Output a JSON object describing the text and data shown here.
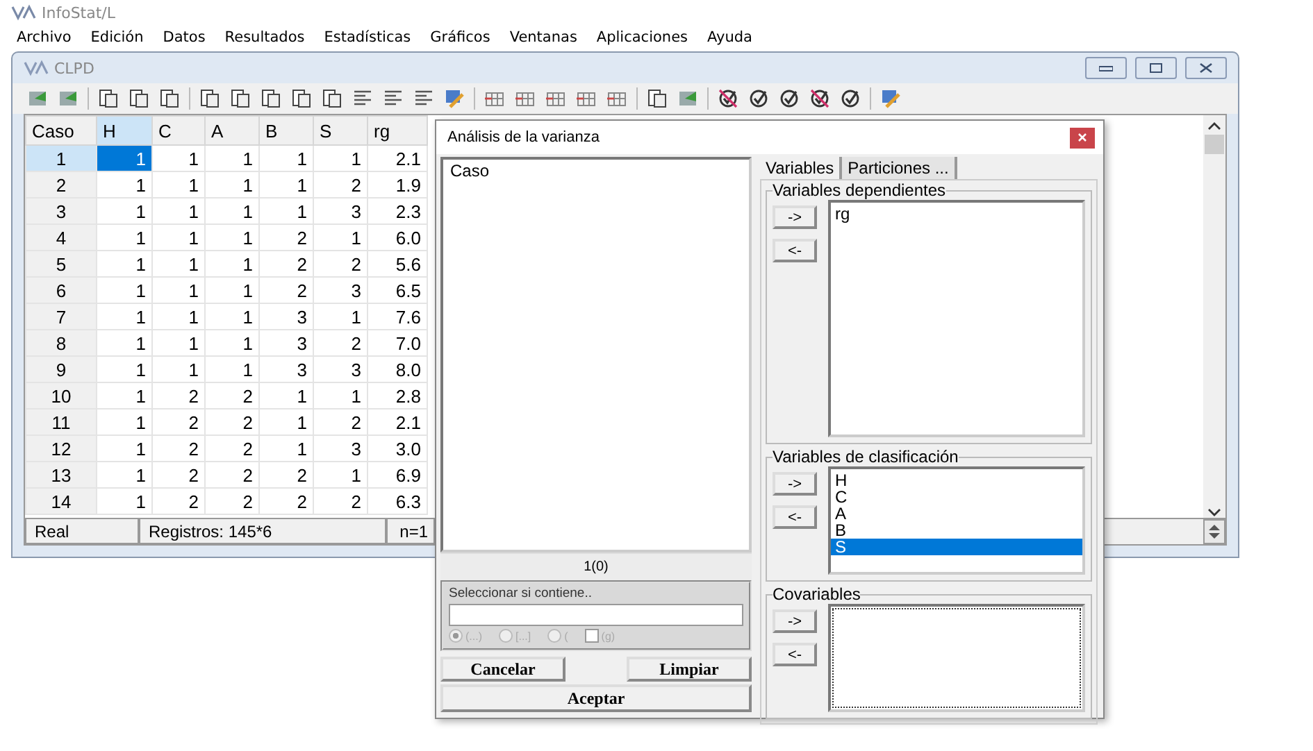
{
  "app": {
    "title": "InfoStat/L"
  },
  "menu": [
    "Archivo",
    "Edición",
    "Datos",
    "Resultados",
    "Estadísticas",
    "Gráficos",
    "Ventanas",
    "Aplicaciones",
    "Ayuda"
  ],
  "data_window": {
    "title": "CLPD",
    "table": {
      "columns": [
        {
          "label": "Caso",
          "selected": false
        },
        {
          "label": "H",
          "selected": true
        },
        {
          "label": "C",
          "selected": false
        },
        {
          "label": "A",
          "selected": false
        },
        {
          "label": "B",
          "selected": false
        },
        {
          "label": "S",
          "selected": false
        },
        {
          "label": "rg",
          "selected": false
        }
      ],
      "rows": [
        {
          "selected": true,
          "cells": [
            "1",
            "1",
            "1",
            "1",
            "1",
            "1",
            "2.1"
          ]
        },
        {
          "selected": false,
          "cells": [
            "2",
            "1",
            "1",
            "1",
            "1",
            "2",
            "1.9"
          ]
        },
        {
          "selected": false,
          "cells": [
            "3",
            "1",
            "1",
            "1",
            "1",
            "3",
            "2.3"
          ]
        },
        {
          "selected": false,
          "cells": [
            "4",
            "1",
            "1",
            "1",
            "2",
            "1",
            "6.0"
          ]
        },
        {
          "selected": false,
          "cells": [
            "5",
            "1",
            "1",
            "1",
            "2",
            "2",
            "5.6"
          ]
        },
        {
          "selected": false,
          "cells": [
            "6",
            "1",
            "1",
            "1",
            "2",
            "3",
            "6.5"
          ]
        },
        {
          "selected": false,
          "cells": [
            "7",
            "1",
            "1",
            "1",
            "3",
            "1",
            "7.6"
          ]
        },
        {
          "selected": false,
          "cells": [
            "8",
            "1",
            "1",
            "1",
            "3",
            "2",
            "7.0"
          ]
        },
        {
          "selected": false,
          "cells": [
            "9",
            "1",
            "1",
            "1",
            "3",
            "3",
            "8.0"
          ]
        },
        {
          "selected": false,
          "cells": [
            "10",
            "1",
            "2",
            "2",
            "1",
            "1",
            "2.8"
          ]
        },
        {
          "selected": false,
          "cells": [
            "11",
            "1",
            "2",
            "2",
            "1",
            "2",
            "2.1"
          ]
        },
        {
          "selected": false,
          "cells": [
            "12",
            "1",
            "2",
            "2",
            "1",
            "3",
            "3.0"
          ]
        },
        {
          "selected": false,
          "cells": [
            "13",
            "1",
            "2",
            "2",
            "2",
            "1",
            "6.9"
          ]
        },
        {
          "selected": false,
          "cells": [
            "14",
            "1",
            "2",
            "2",
            "2",
            "2",
            "6.3"
          ]
        }
      ]
    },
    "status_bar": [
      "Real",
      "Registros: 145*6",
      "n=1"
    ]
  },
  "dialog": {
    "title": "Análisis de la varianza",
    "source_list": [
      {
        "label": "Caso",
        "selected": false
      }
    ],
    "count": "1(0)",
    "filter": {
      "label": "Seleccionar si contiene..",
      "options": [
        {
          "label": "(...)",
          "selected": true
        },
        {
          "label": "[...]",
          "selected": false
        },
        {
          "label": "(",
          "selected": false
        }
      ],
      "checkbox": {
        "label": "(g)",
        "checked": false
      }
    },
    "buttons": [
      "Cancelar",
      "Limpiar",
      "Aceptar"
    ],
    "tabs": [
      {
        "label": "Variables",
        "selected": true
      },
      {
        "label": "Particiones ...",
        "selected": false
      }
    ],
    "groups": [
      {
        "title": "Variables dependientes",
        "add": "->",
        "remove": "<-",
        "items": [
          {
            "label": "rg",
            "selected": false
          }
        ]
      },
      {
        "title": "Variables de clasificación",
        "add": "->",
        "remove": "<-",
        "items": [
          {
            "label": "H",
            "selected": false
          },
          {
            "label": "C",
            "selected": false
          },
          {
            "label": "A",
            "selected": false
          },
          {
            "label": "B",
            "selected": false
          },
          {
            "label": "S",
            "selected": true
          }
        ]
      },
      {
        "title": "Covariables",
        "add": "->",
        "remove": "<-"
      }
    ]
  }
}
